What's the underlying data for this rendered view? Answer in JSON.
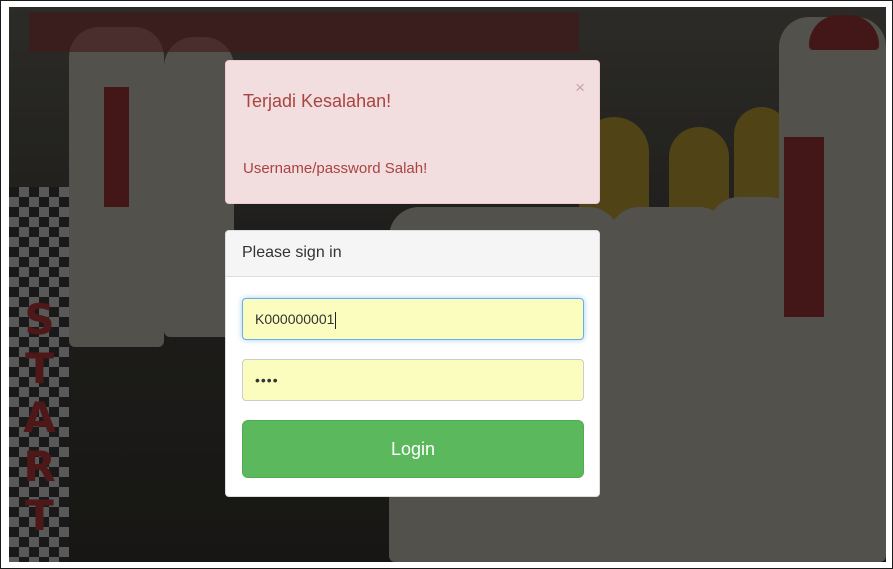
{
  "alert": {
    "title": "Terjadi Kesalahan!",
    "message": "Username/password Salah!",
    "close_label": "×"
  },
  "login_panel": {
    "heading": "Please sign in",
    "username_value": "K000000001",
    "password_masked": "••••",
    "login_label": "Login"
  },
  "background": {
    "banner_text": "START"
  },
  "colors": {
    "alert_bg": "#f2dede",
    "alert_text": "#a94442",
    "input_autofill_bg": "#fbfdbe",
    "button_success": "#5cb85c"
  }
}
